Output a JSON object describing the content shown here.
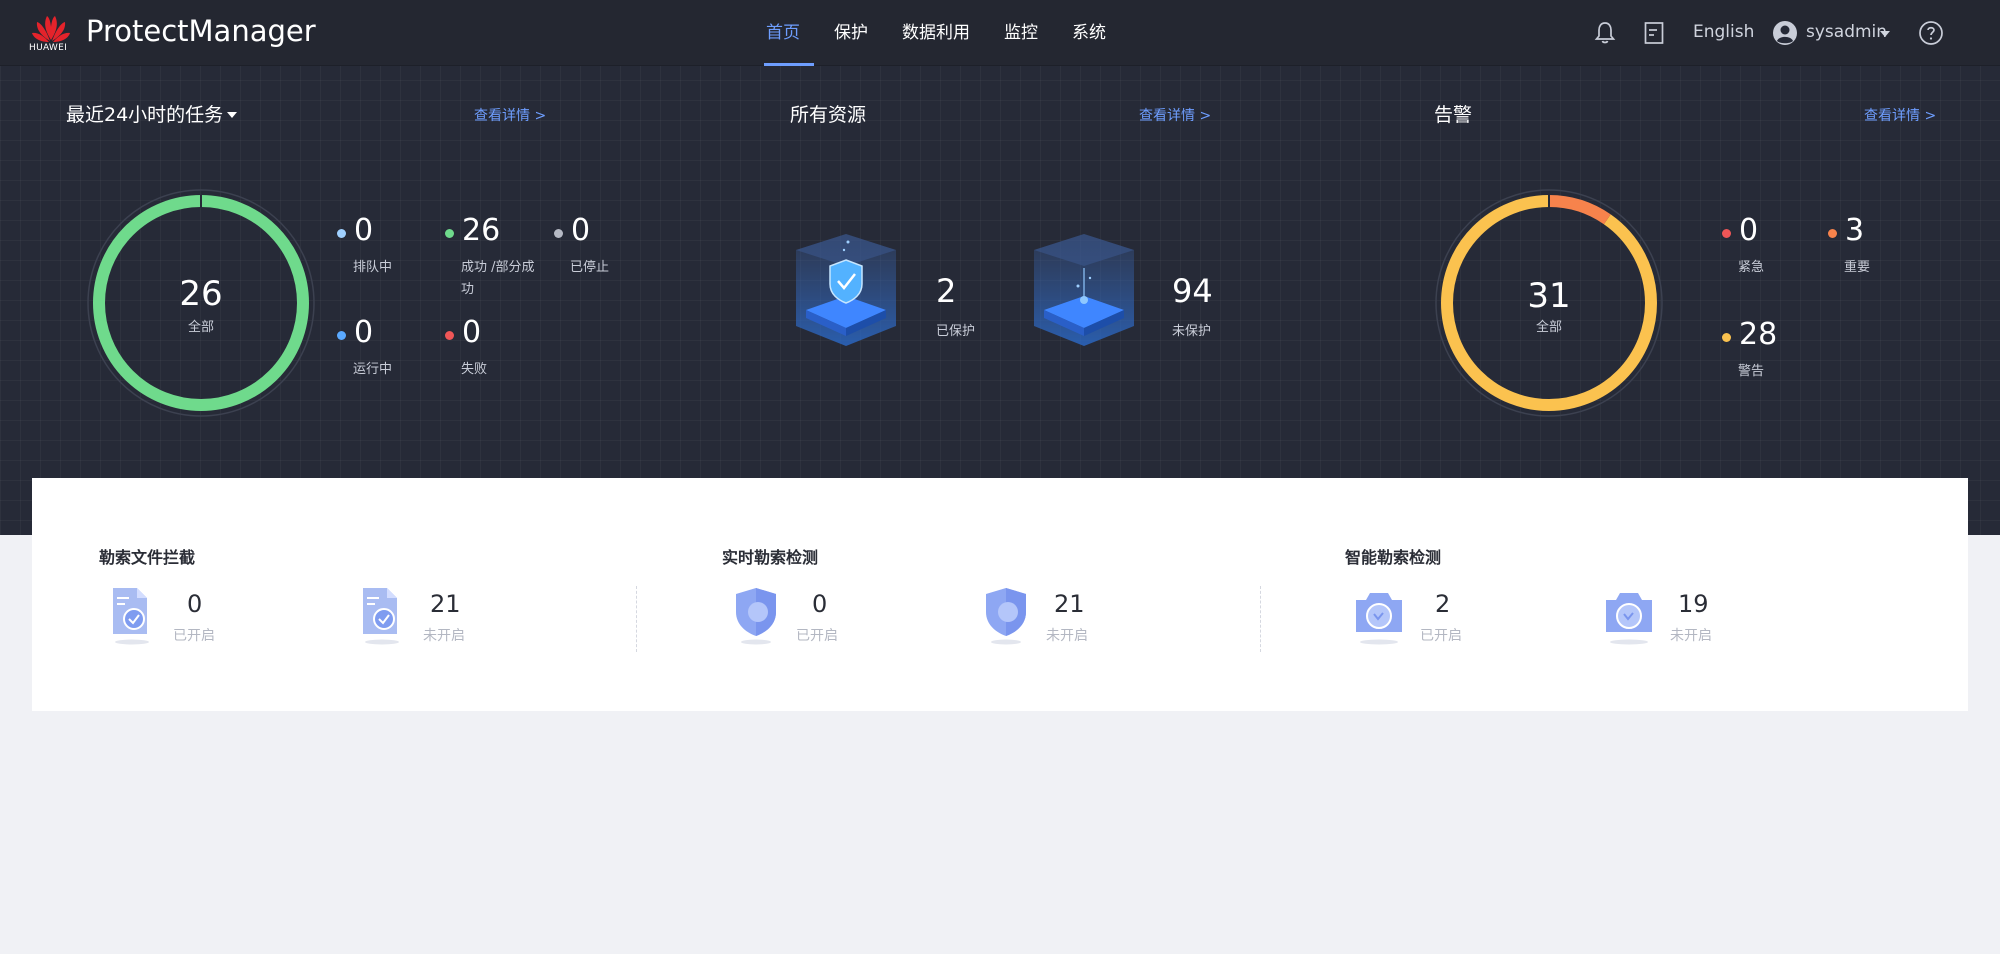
{
  "header": {
    "brand": "HUAWEI",
    "app_title": "ProtectManager",
    "nav": [
      "首页",
      "保护",
      "数据利用",
      "监控",
      "系统"
    ],
    "language": "English",
    "username": "sysadmin",
    "icons": [
      "bell-icon",
      "document-icon",
      "user-avatar-icon",
      "help-icon"
    ]
  },
  "tasks": {
    "title": "最近24小时的任务",
    "detail_link": "查看详情 >",
    "total": "26",
    "total_label": "全部",
    "stats": [
      {
        "value": "0",
        "label": "排队中",
        "color": "#9fd0ff"
      },
      {
        "value": "26",
        "label": "成功 /部分成功",
        "color": "#6fda8c"
      },
      {
        "value": "0",
        "label": "已停止",
        "color": "#b5b9c4"
      },
      {
        "value": "0",
        "label": "运行中",
        "color": "#5aa9ff"
      },
      {
        "value": "0",
        "label": "失败",
        "color": "#ef5657"
      }
    ],
    "ring_color": "#6fda8c"
  },
  "resources": {
    "title": "所有资源",
    "detail_link": "查看详情 >",
    "protected_value": "2",
    "protected_label": "已保护",
    "unprotected_value": "94",
    "unprotected_label": "未保护"
  },
  "alarms": {
    "title": "告警",
    "detail_link": "查看详情 >",
    "total": "31",
    "total_label": "全部",
    "stats": [
      {
        "value": "0",
        "label": "紧急",
        "color": "#ef5657"
      },
      {
        "value": "3",
        "label": "重要",
        "color": "#f7834c"
      },
      {
        "value": "28",
        "label": "警告",
        "color": "#fbc24f"
      }
    ]
  },
  "features": [
    {
      "title": "勒索文件拦截",
      "items": [
        {
          "value": "0",
          "label": "已开启"
        },
        {
          "value": "21",
          "label": "未开启"
        }
      ],
      "icon": "file-block-icon"
    },
    {
      "title": "实时勒索检测",
      "items": [
        {
          "value": "0",
          "label": "已开启"
        },
        {
          "value": "21",
          "label": "未开启"
        }
      ],
      "icon": "shield-icon"
    },
    {
      "title": "智能勒索检测",
      "items": [
        {
          "value": "2",
          "label": "已开启"
        },
        {
          "value": "19",
          "label": "未开启"
        }
      ],
      "icon": "camera-icon"
    }
  ],
  "colors": {
    "accent": "#6e9eff",
    "hero_bg": "#262a37",
    "page_bg": "#f0f1f5"
  }
}
